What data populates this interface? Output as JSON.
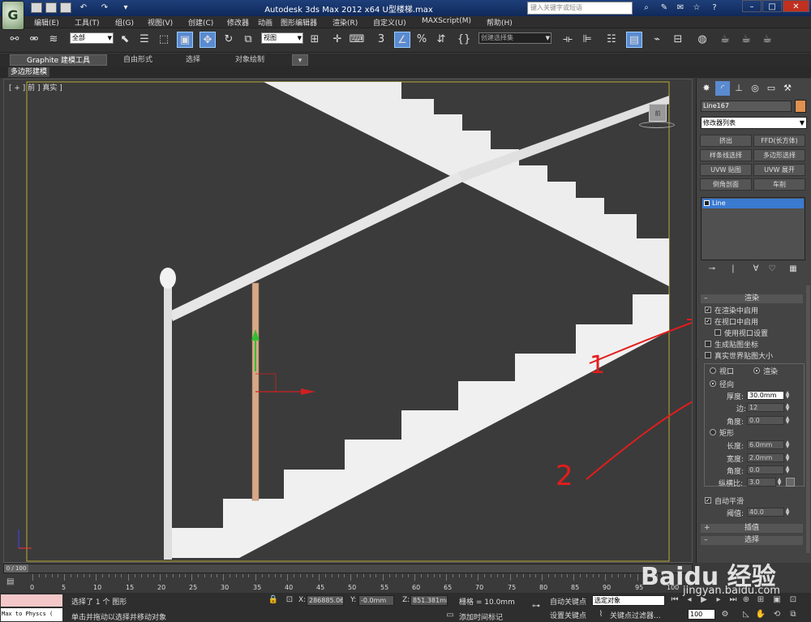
{
  "titlebar": {
    "title": "Autodesk 3ds Max  2012 x64      U型楼梯.max",
    "search_placeholder": "键入关键字或短语",
    "app_logo": "G"
  },
  "menu": [
    "编辑(E)",
    "工具(T)",
    "组(G)",
    "视图(V)",
    "创建(C)",
    "修改器",
    "动画",
    "图形编辑器",
    "渲染(R)",
    "自定义(U)",
    "MAXScript(M)",
    "帮助(H)"
  ],
  "toolbar": {
    "selection_filter": "全部",
    "reference_coord": "视图",
    "named_selection": "创建选择集",
    "snap_label": "3"
  },
  "ribbon": {
    "tabs": [
      "Graphite 建模工具",
      "自由形式",
      "选择",
      "对象绘制"
    ],
    "sub_label": "多边形建模"
  },
  "viewport": {
    "label": "[ + ] 前 ] 真实 ]",
    "viewcube_label": "前"
  },
  "command_panel": {
    "object_name": "Line167",
    "object_color": "#e09050",
    "modifier_list": "修改器列表",
    "modifier_buttons": [
      "挤出",
      "FFD(长方体)",
      "样条线选择",
      "多边形选择",
      "UVW 贴图",
      "UVW 展开",
      "倒角剖面",
      "车削"
    ],
    "stack_item": "Line",
    "rendering": {
      "title": "渲染",
      "enable_in_renderer": "在渲染中启用",
      "enable_in_viewport": "在视口中启用",
      "use_viewport_settings": "使用视口设置",
      "generate_mapping": "生成贴图坐标",
      "real_world_map": "真实世界贴图大小",
      "viewport_radio": "视口",
      "render_radio": "渲染",
      "radial": "径向",
      "thickness_label": "厚度:",
      "thickness_value": "30.0mm",
      "sides_label": "边:",
      "sides_value": "12",
      "angle_label": "角度:",
      "angle_value": "0.0",
      "rectangular": "矩形",
      "length_label": "长度:",
      "length_value": "6.0mm",
      "width_label": "宽度:",
      "width_value": "2.0mm",
      "rect_angle_label": "角度:",
      "rect_angle_value": "0.0",
      "aspect_label": "纵横比:",
      "aspect_value": "3.0",
      "auto_smooth": "自动平滑",
      "threshold_label": "阈值:",
      "threshold_value": "40.0"
    },
    "interpolation": "插值",
    "selection": "选择"
  },
  "timeline": {
    "slider_label": "0 / 100",
    "ticks": [
      "0",
      "5",
      "10",
      "15",
      "20",
      "25",
      "30",
      "35",
      "40",
      "45",
      "50",
      "55",
      "60",
      "65",
      "70",
      "75",
      "80",
      "85",
      "90",
      "95",
      "100"
    ]
  },
  "statusbar": {
    "maxscript": "Max to Physcs (",
    "selected_text": "选择了 1 个 图形",
    "prompt_text": "单击并拖动以选择并移动对象",
    "x_label": "X:",
    "x_value": "286885.06",
    "y_label": "Y:",
    "y_value": "-0.0mm",
    "z_label": "Z:",
    "z_value": "851.381mm",
    "grid_text": "栅格 = 10.0mm",
    "add_time_tag": "添加时间标记",
    "auto_key": "自动关键点",
    "set_key": "设置关键点",
    "key_mode": "选定对象",
    "key_filters": "关键点过滤器...",
    "frame_value": "100"
  },
  "annotations": {
    "mark1": "1",
    "mark2": "2"
  },
  "watermark": {
    "brand": "Baidu 经验",
    "url": "jingyan.baidu.com"
  }
}
